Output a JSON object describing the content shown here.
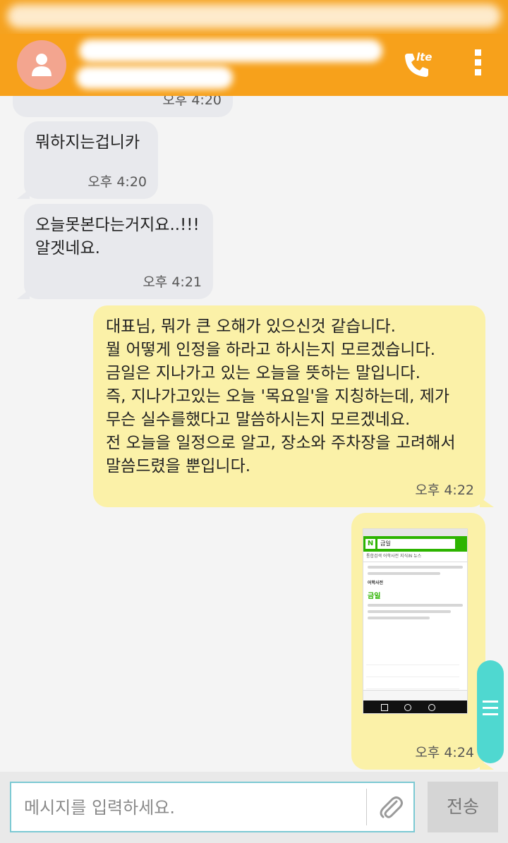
{
  "header": {
    "contact_name": "",
    "call_badge": "lte"
  },
  "messages": [
    {
      "side": "received",
      "text": "",
      "time": "오후 4:20"
    },
    {
      "side": "received",
      "text": "뭐하지는겁니카",
      "time": "오후 4:20"
    },
    {
      "side": "received",
      "text": "오늘못본다는거지요..!!!\n알겟네요.",
      "time": "오후 4:21"
    },
    {
      "side": "sent",
      "text": "대표님, 뭐가 큰 오해가 있으신것 같습니다.\n뭘 어떻게 인정을 하라고 하시는지 모르겠습니다.\n금일은 지나가고 있는 오늘을 뜻하는 말입니다.\n즉, 지나가고있는 오늘 '목요일'을 지칭하는데, 제가\n무슨 실수를했다고 말씀하시는지 모르겠네요.\n전 오늘을 일정으로 알고, 장소와 주차장을 고려해서\n말씀드렸을 뿐입니다.",
      "time": "오후 4:22"
    },
    {
      "side": "sent",
      "type": "image",
      "time": "오후 4:24",
      "image": {
        "search_query": "금일",
        "tabs": "통합검색   어학사전   지식iN   뉴스",
        "headword": "금일",
        "section": "어학사전"
      }
    }
  ],
  "composer": {
    "placeholder": "메시지를 입력하세요.",
    "send_label": "전송"
  }
}
